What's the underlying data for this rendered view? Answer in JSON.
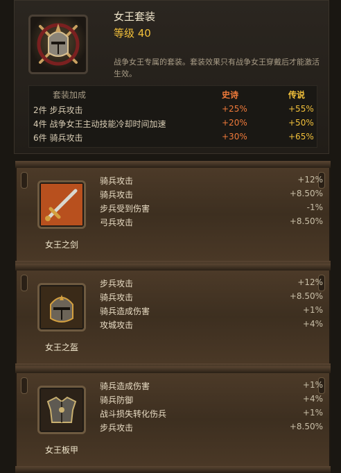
{
  "set": {
    "title": "女王套装",
    "level": "等级 40",
    "description": "战争女王专属的套装。套装效果只有战争女王穿戴后才能激活生效。",
    "icon": "knight-helmet-crest-icon",
    "bonus_header": {
      "name": "套装加成",
      "epic": "史诗",
      "legendary": "传说"
    },
    "bonuses": [
      {
        "name": "2件 步兵攻击",
        "epic": "+25%",
        "legendary": "+55%"
      },
      {
        "name": "4件 战争女王主动技能冷却时间加速",
        "epic": "+20%",
        "legendary": "+50%"
      },
      {
        "name": "6件 骑兵攻击",
        "epic": "+30%",
        "legendary": "+65%"
      }
    ]
  },
  "items": [
    {
      "name": "女王之剑",
      "icon": "sword-icon",
      "stats": [
        {
          "name": "骑兵攻击",
          "value": "+12%"
        },
        {
          "name": "骑兵攻击",
          "value": "+8.50%"
        },
        {
          "name": "步兵受到伤害",
          "value": "-1%"
        },
        {
          "name": "弓兵攻击",
          "value": "+8.50%"
        }
      ]
    },
    {
      "name": "女王之盔",
      "icon": "helmet-icon",
      "stats": [
        {
          "name": "步兵攻击",
          "value": "+12%"
        },
        {
          "name": "骑兵攻击",
          "value": "+8.50%"
        },
        {
          "name": "骑兵造成伤害",
          "value": "+1%"
        },
        {
          "name": "攻城攻击",
          "value": "+4%"
        }
      ]
    },
    {
      "name": "女王板甲",
      "icon": "chest-armor-icon",
      "stats": [
        {
          "name": "骑兵造成伤害",
          "value": "+1%"
        },
        {
          "name": "骑兵防御",
          "value": "+4%"
        },
        {
          "name": "战斗损失转化伤兵",
          "value": "+1%"
        },
        {
          "name": "步兵攻击",
          "value": "+8.50%"
        }
      ]
    }
  ]
}
